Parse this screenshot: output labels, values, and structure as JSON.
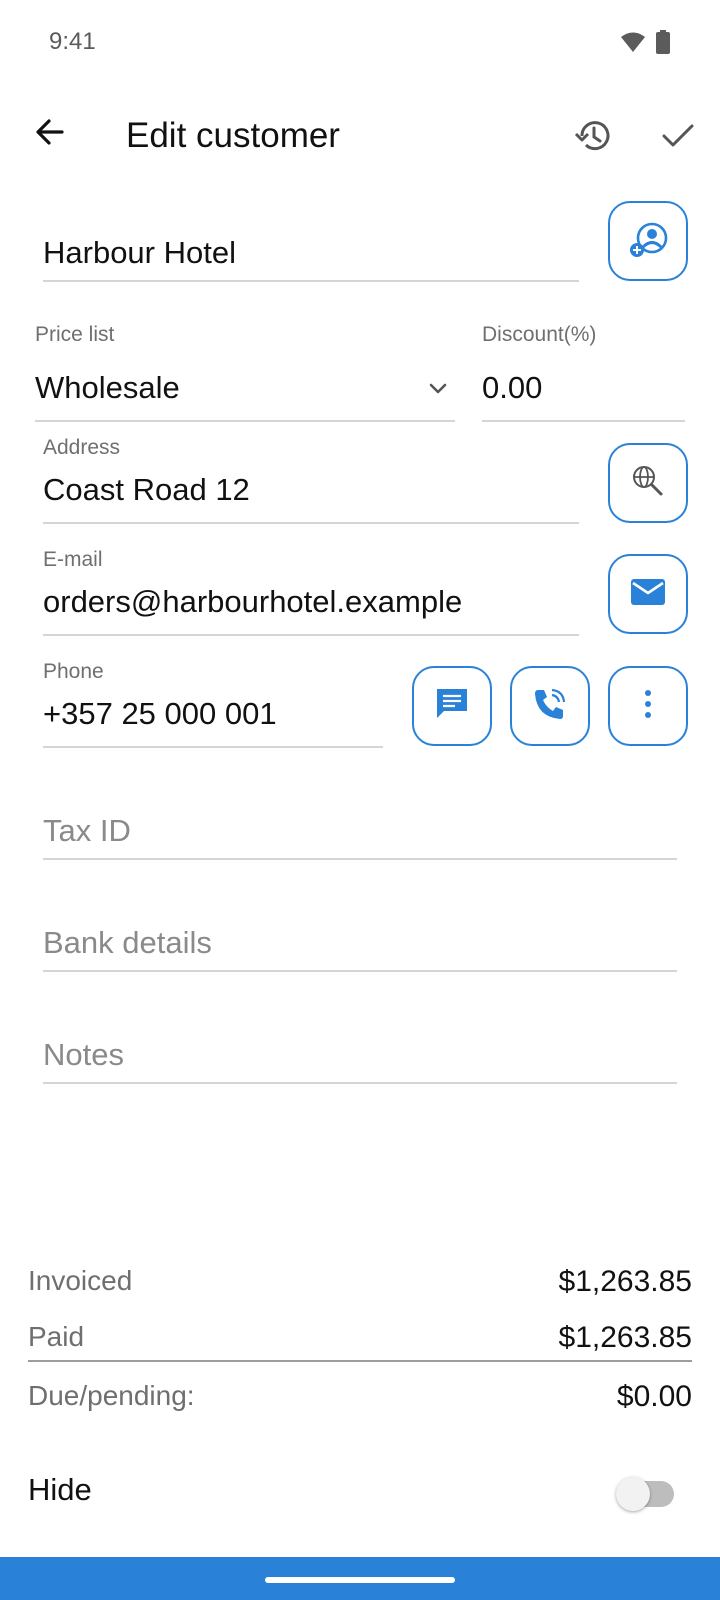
{
  "status_bar": {
    "time": "9:41",
    "icons": [
      "wifi-icon",
      "battery-icon"
    ]
  },
  "topbar": {
    "title": "Edit customer",
    "icons": [
      "back-arrow-icon",
      "history-icon",
      "check-icon"
    ]
  },
  "form": {
    "name_value": "Harbour Hotel",
    "price_list": {
      "label": "Price list",
      "value": "Wholesale"
    },
    "discount": {
      "label": "Discount(%)",
      "value": "0.00"
    },
    "address": {
      "label": "Address",
      "value": "Coast Road 12"
    },
    "email": {
      "label": "E-mail",
      "value": "orders@harbourhotel.example"
    },
    "phone": {
      "label": "Phone",
      "value": "+357 25 000 001"
    },
    "tax_id_placeholder": "Tax ID",
    "bank_details_placeholder": "Bank details",
    "notes_placeholder": "Notes"
  },
  "summary": {
    "invoiced_label": "Invoiced",
    "invoiced_value": "$1,263.85",
    "paid_label": "Paid",
    "paid_value": "$1,263.85",
    "due_label": "Due/pending:",
    "due_value": "$0.00"
  },
  "hide": {
    "label": "Hide",
    "enabled": false
  },
  "colors": {
    "accent": "#2a82d8",
    "text_primary": "#111111",
    "text_secondary": "#6f6f6f",
    "divider": "#d5d5d5"
  }
}
